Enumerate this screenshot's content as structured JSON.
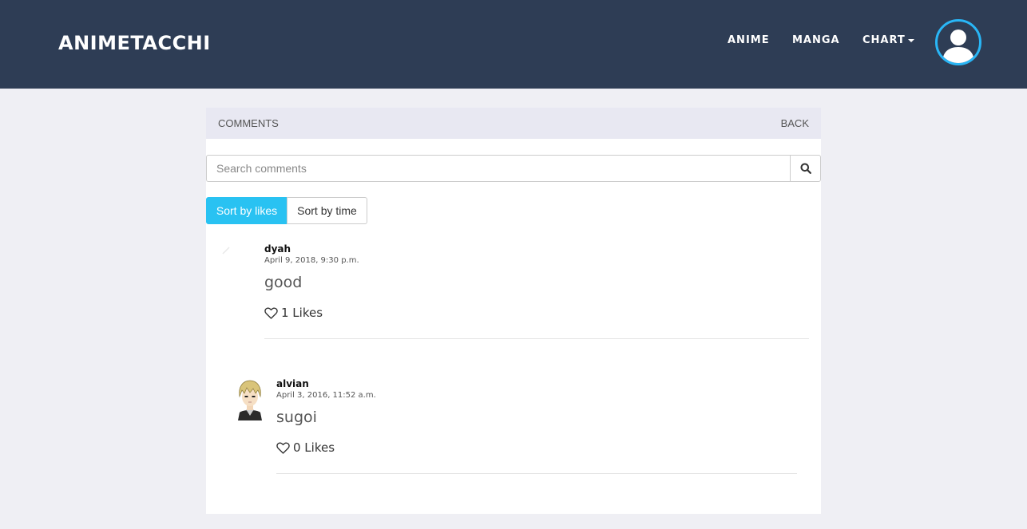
{
  "navbar": {
    "brand": "ANIMETACCHI",
    "items": [
      {
        "label": "ANIME"
      },
      {
        "label": "MANGA"
      },
      {
        "label": "CHART"
      }
    ]
  },
  "panel": {
    "title": "COMMENTS",
    "back_label": "BACK"
  },
  "search": {
    "placeholder": "Search comments",
    "value": ""
  },
  "sort": {
    "likes_label": "Sort by likes",
    "time_label": "Sort by time",
    "active": "likes"
  },
  "comments": [
    {
      "user": "dyah",
      "date": "April 9, 2018, 9:30 p.m.",
      "text": "good",
      "likes": "1 Likes"
    },
    {
      "user": "alvian",
      "date": "April 3, 2016, 11:52 a.m.",
      "text": "sugoi",
      "likes": "0 Likes"
    }
  ],
  "colors": {
    "navbar": "#2e3d55",
    "accent": "#29c2f2",
    "avatar_ring": "#29b6f6",
    "background": "#efeff4",
    "panel_header": "#e8e8f2"
  }
}
